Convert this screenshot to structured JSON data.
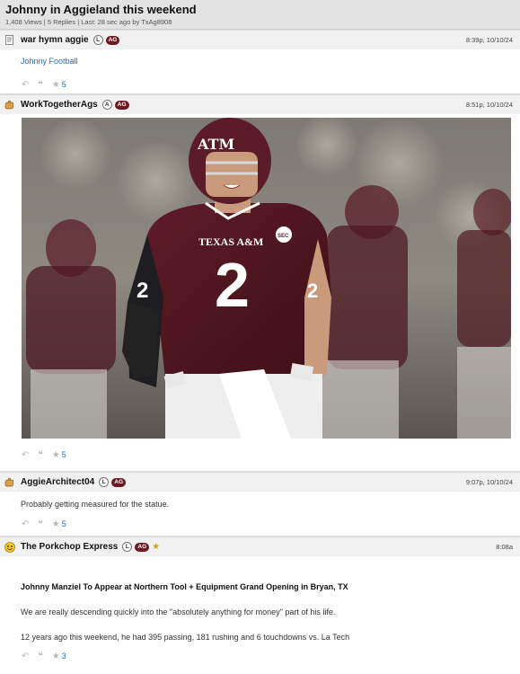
{
  "thread": {
    "title": "Johnny in Aggieland this weekend",
    "meta": "1,408 Views | 5 Replies | Last: 28 sec ago by TxAg8908"
  },
  "posts": [
    {
      "author": "war hymn aggie",
      "badges": [
        "L",
        "AG"
      ],
      "time": "8:39p, 10/10/24",
      "body_link": "Johnny Football",
      "likes": "5",
      "avatar_icon": "document-icon"
    },
    {
      "author": "WorkTogetherAgs",
      "badges": [
        "A",
        "AG"
      ],
      "time": "8:51p, 10/10/24",
      "likes": "5",
      "avatar_icon": "hand-icon",
      "photo": {
        "jersey_text": "TEXAS A&M",
        "jersey_number": "2",
        "helmet_logo": "ATM",
        "patch_text": "SEC"
      }
    },
    {
      "author": "AggieArchitect04",
      "badges": [
        "L",
        "AG"
      ],
      "time": "9:07p, 10/10/24",
      "body_text": "Probably getting measured for the statue.",
      "likes": "5",
      "avatar_icon": "hand-icon"
    },
    {
      "author": "The Porkchop Express",
      "badges": [
        "L",
        "AG",
        "★"
      ],
      "time": "8:08a",
      "article_title": "Johnny Manziel To Appear at Northern Tool + Equipment Grand Opening in Bryan, TX",
      "paragraph1": "We are really descending quickly into the \"absolutely anything for money\" part of his life.",
      "paragraph2": "12 years ago this weekend, he had 395 passing, 181 rushing and 6 touchdowns vs. La Tech",
      "likes": "3",
      "avatar_icon": "smiley-icon"
    }
  ],
  "colors": {
    "maroon": "#6b1a22",
    "link_blue": "#2f6db8",
    "header_gray": "#e3e3e3"
  }
}
